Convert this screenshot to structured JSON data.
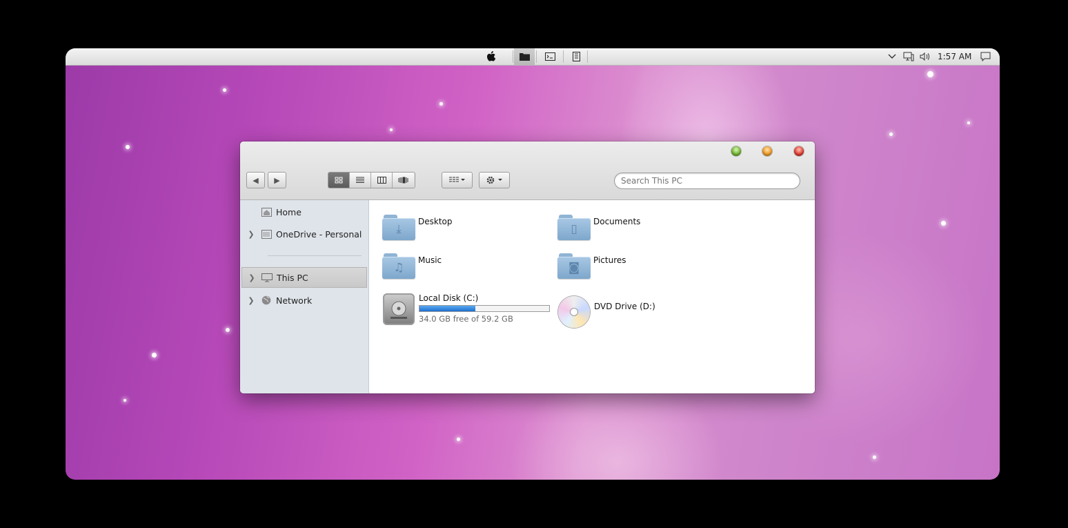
{
  "menubar": {
    "icons": [
      "apple-icon",
      "folder-icon",
      "terminal-icon",
      "panel-icon"
    ],
    "tray": [
      "chevron-up-icon",
      "network-icon",
      "volume-icon",
      "notification-icon"
    ],
    "clock": "1:57 AM"
  },
  "window": {
    "controls": [
      "minimize",
      "maximize",
      "close"
    ],
    "toolbar": {
      "back": "◀",
      "forward": "▶",
      "views": [
        "icons",
        "list",
        "columns",
        "cover-flow"
      ],
      "active_view": "icons"
    },
    "search": {
      "placeholder": "Search This PC",
      "value": ""
    },
    "sidebar": {
      "items": [
        {
          "label": "Home",
          "icon": "home-icon"
        },
        {
          "label": "OneDrive - Personal",
          "icon": "onedrive-icon"
        },
        {
          "label": "This PC",
          "icon": "computer-icon",
          "selected": true
        },
        {
          "label": "Network",
          "icon": "network-globe-icon"
        }
      ]
    },
    "content": {
      "folders": [
        {
          "label": "Desktop",
          "glyph": "⤓"
        },
        {
          "label": "Documents",
          "glyph": "▯"
        },
        {
          "label": "Music",
          "glyph": "♫"
        },
        {
          "label": "Pictures",
          "glyph": "◙"
        }
      ],
      "drives": [
        {
          "label": "Local Disk (C:)",
          "free_text": "34.0 GB free of 59.2 GB",
          "used_fraction": 0.43
        },
        {
          "label": "DVD Drive (D:)"
        }
      ]
    }
  }
}
